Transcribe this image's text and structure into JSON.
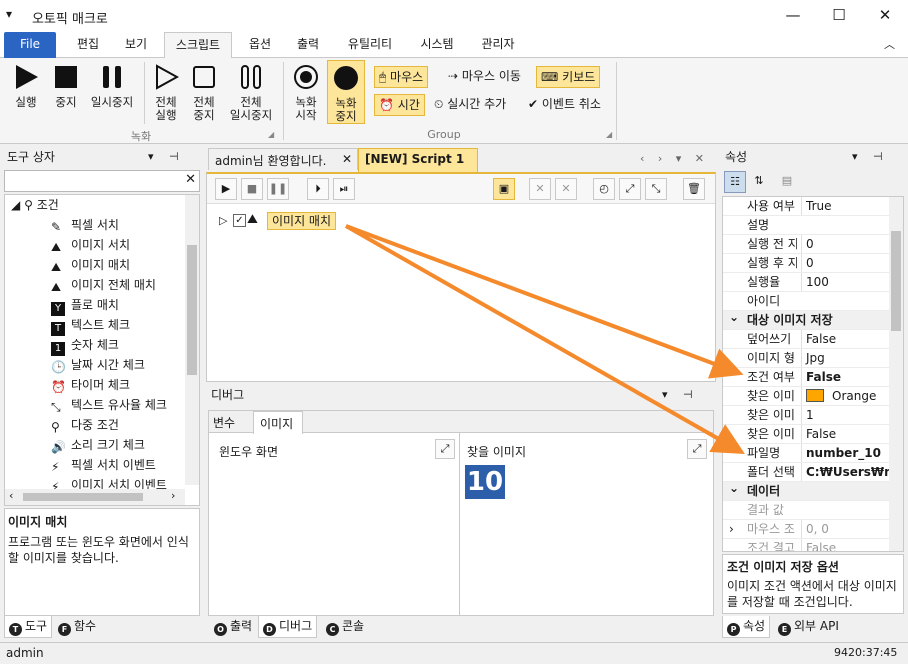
{
  "window": {
    "title": "오토픽 매크로",
    "sysmenu": "▾",
    "minimize": "—",
    "maximize": "☐",
    "close": "✕"
  },
  "menu": {
    "file": "File",
    "tabs": [
      "편집",
      "보기",
      "스크립트",
      "옵션",
      "출력",
      "유틸리티",
      "시스템",
      "관리자"
    ],
    "collapse": "︿"
  },
  "ribbon": {
    "run": "실행",
    "stop": "중지",
    "pause": "일시중지",
    "all_run_1": "전체",
    "all_run_2": "실행",
    "all_stop_1": "전체",
    "all_stop_2": "중지",
    "all_pause_1": "전체",
    "all_pause_2": "일시중지",
    "group1": "녹화",
    "rec_start_1": "녹화",
    "rec_start_2": "시작",
    "rec_stop_1": "녹화",
    "rec_stop_2": "중지",
    "mouse": "마우스",
    "mouse_move": "마우스 이동",
    "keyboard": "키보드",
    "time": "시간",
    "realtime_add": "실시간 추가",
    "cancel_event": "이벤트 취소",
    "group2": "Group"
  },
  "toolbox": {
    "title": "도구 상자",
    "search_placeholder": "",
    "category": "조건",
    "items": [
      "픽셀 서치",
      "이미지 서치",
      "이미지 매치",
      "이미지 전체 매치",
      "플로 매치",
      "텍스트 체크",
      "숫자 체크",
      "날짜 시간 체크",
      "타이머 체크",
      "텍스트 유사율 체크",
      "다중 조건",
      "소리 크기 체크",
      "픽셀 서치 이벤트",
      "이미지 서치 이벤트"
    ],
    "desc_title": "이미지 매치",
    "desc_text": "프로그램 또는 윈도우 화면에서 인식할 이미지를 찾습니다.",
    "tab_tools": "도구",
    "tab_funcs": "함수",
    "tab_tools_ic": "T",
    "tab_funcs_ic": "F"
  },
  "editor": {
    "tab1": "admin님 환영합니다.",
    "tab2": "[NEW] Script 1",
    "node_label": "이미지 매치"
  },
  "debug": {
    "title": "디버그",
    "tab_vars": "변수",
    "tab_image": "이미지",
    "window_screen": "윈도우 화면",
    "find_image": "찾을 이미지",
    "found_value": "10",
    "tab_output": "출력",
    "tab_debug": "디버그",
    "tab_console": "콘솔",
    "tab_output_ic": "O",
    "tab_debug_ic": "D",
    "tab_console_ic": "C"
  },
  "properties": {
    "title": "속성",
    "rows": [
      {
        "k": "사용 여부",
        "v": "True"
      },
      {
        "k": "설명",
        "v": ""
      },
      {
        "k": "실행 전 지",
        "v": "0"
      },
      {
        "k": "실행 후 지",
        "v": "0"
      },
      {
        "k": "실행율",
        "v": "100"
      },
      {
        "k": "아이디",
        "v": ""
      }
    ],
    "cat1": "대상 이미지 저장",
    "rows2": [
      {
        "k": "덮어쓰기",
        "v": "False"
      },
      {
        "k": "이미지 형",
        "v": "Jpg"
      },
      {
        "k": "조건 여부",
        "v": "False"
      },
      {
        "k": "찾은 이미",
        "v": "Orange"
      },
      {
        "k": "찾은 이미",
        "v": "1"
      },
      {
        "k": "찾은 이미",
        "v": "False"
      },
      {
        "k": "파일명",
        "v": "number_10"
      },
      {
        "k": "폴더 선택",
        "v": "C:₩Users₩ngm"
      }
    ],
    "cat2": "데이터",
    "rows3": [
      {
        "k": "결과 값",
        "v": ""
      },
      {
        "k": "마우스 조",
        "v": "0, 0"
      },
      {
        "k": "조건 결고",
        "v": "False"
      }
    ],
    "orange_color": "#ffa500",
    "desc_title": "조건 이미지 저장 옵션",
    "desc_text": "이미지 조건 액션에서 대상 이미지를 저장할 때 조건입니다.",
    "tab_props": "속성",
    "tab_api": "외부 API",
    "tab_props_ic": "P",
    "tab_api_ic": "E"
  },
  "status": {
    "user": "admin",
    "time": "9420:37:45"
  },
  "colors": {
    "accent_blue": "#2b65c4",
    "highlight": "#fde59a",
    "arrow": "#f58a2c",
    "number_tile": "#2d5ea9"
  }
}
